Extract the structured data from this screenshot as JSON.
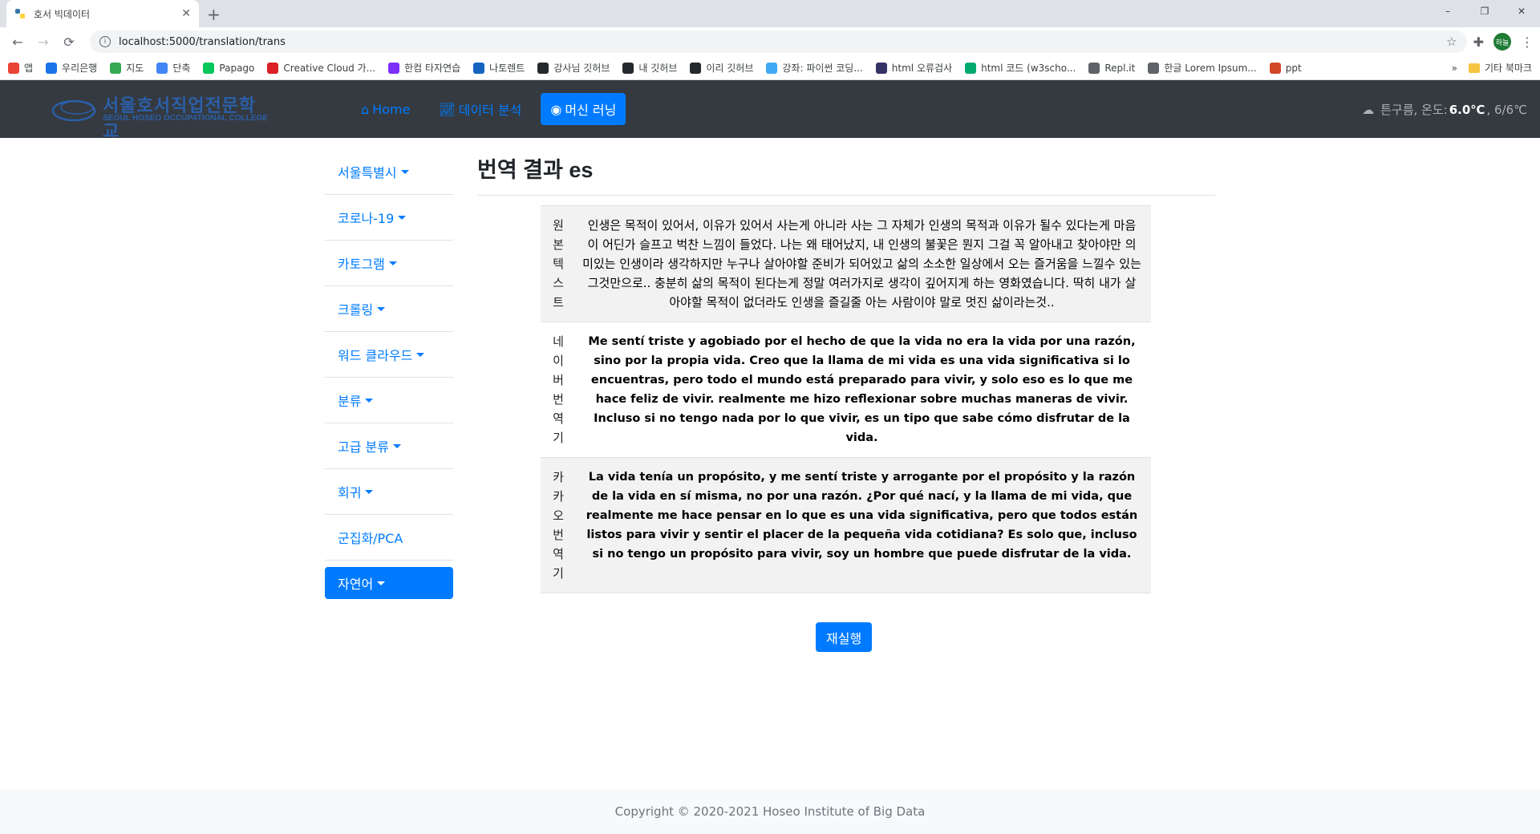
{
  "browser": {
    "tab_title": "호서 빅데이터",
    "url": "localhost:5000/translation/trans",
    "window_controls": [
      "–",
      "❐",
      "✕"
    ],
    "bookmarks": [
      {
        "label": "앱",
        "color": "#ea4335"
      },
      {
        "label": "우리은행",
        "color": "#1a73e8"
      },
      {
        "label": "지도",
        "color": "#34a853"
      },
      {
        "label": "단축",
        "color": "#4285f4"
      },
      {
        "label": "Papago",
        "color": "#03c75a"
      },
      {
        "label": "Creative Cloud 가...",
        "color": "#da1f26"
      },
      {
        "label": "한컴 타자연습",
        "color": "#7b2ff7"
      },
      {
        "label": "나토렌트",
        "color": "#1565c0"
      },
      {
        "label": "강사님 깃허브",
        "color": "#24292e"
      },
      {
        "label": "내 깃허브",
        "color": "#24292e"
      },
      {
        "label": "이리 깃허브",
        "color": "#24292e"
      },
      {
        "label": "강좌: 파이썬 코딩...",
        "color": "#3fa9f5"
      },
      {
        "label": "html 오류검사",
        "color": "#333366"
      },
      {
        "label": "html 코드 (w3scho...",
        "color": "#04aa6d"
      },
      {
        "label": "Repl.it",
        "color": "#5f6368"
      },
      {
        "label": "한글 Lorem Ipsum...",
        "color": "#5f6368"
      },
      {
        "label": "ppt",
        "color": "#d24726"
      }
    ],
    "bookmarks_overflow": "»",
    "other_bookmarks": "기타 북마크",
    "profile_initial": "하늘"
  },
  "navbar": {
    "logo_title": "서울호서직업전문학교",
    "logo_subtitle": "SEOUL HOSEO OCCUPATIONAL COLLEGE",
    "links": [
      {
        "label": "Home",
        "icon": "home-icon",
        "active": false
      },
      {
        "label": "데이터 분석",
        "icon": "chart-line-icon",
        "active": false
      },
      {
        "label": "머신 러닝",
        "icon": "brain-icon",
        "active": true
      }
    ],
    "weather": {
      "condition": "튼구름, 온도: ",
      "temp": "6.0℃",
      "range": ", 6/6℃"
    }
  },
  "sidebar": {
    "items": [
      {
        "label": "서울특별시",
        "dropdown": true
      },
      {
        "label": "코로나-19",
        "dropdown": true
      },
      {
        "label": "카토그램",
        "dropdown": true
      },
      {
        "label": "크롤링",
        "dropdown": true
      },
      {
        "label": "워드 클라우드",
        "dropdown": true
      },
      {
        "label": "분류",
        "dropdown": true
      },
      {
        "label": "고급 분류",
        "dropdown": true
      },
      {
        "label": "회귀",
        "dropdown": true
      },
      {
        "label": "군집화/PCA",
        "dropdown": false
      },
      {
        "label": "자연어",
        "dropdown": true,
        "active": true
      }
    ]
  },
  "main": {
    "title": "번역 결과 es",
    "rows": [
      {
        "label": "원본텍스트",
        "text": "인생은 목적이 있어서, 이유가 있어서 사는게 아니라 사는 그 자체가 인생의 목적과 이유가 될수 있다는게 마음이 어딘가 슬프고 벅찬 느낌이 들었다. 나는 왜 태어났지, 내 인생의 불꽃은 뭔지 그걸 꼭 알아내고 찾아야만 의미있는 인생이라 생각하지만 누구나 살아야할 준비가 되어있고 삶의 소소한 일상에서 오는 즐거움을 느낄수 있는 그것만으로.. 충분히 삶의 목적이 된다는게 정말 여러가지로 생각이 깊어지게 하는 영화였습니다. 딱히 내가 살아야할 목적이 없더라도 인생을 즐길줄 아는 사람이야 말로 멋진 삶이라는것..",
        "bold": false
      },
      {
        "label": "네이버번역기",
        "text": "Me sentí triste y agobiado por el hecho de que la vida no era la vida por una razón, sino por la propia vida. Creo que la llama de mi vida es una vida significativa si lo encuentras, pero todo el mundo está preparado para vivir, y solo eso es lo que me hace feliz de vivir. realmente me hizo reflexionar sobre muchas maneras de vivir. Incluso si no tengo nada por lo que vivir, es un tipo que sabe cómo disfrutar de la vida.",
        "bold": true
      },
      {
        "label": "카카오번역기",
        "text": "La vida tenía un propósito, y me sentí triste y arrogante por el propósito y la razón de la vida en sí misma, no por una razón. ¿Por qué nací, y la llama de mi vida, que realmente me hace pensar en lo que es una vida significativa, pero que todos están listos para vivir y sentir el placer de la pequeña vida cotidiana? Es solo que, incluso si no tengo un propósito para vivir, soy un hombre que puede disfrutar de la vida.",
        "bold": true
      }
    ],
    "rerun_label": "재실행"
  },
  "footer": {
    "copyright": "Copyright © 2020-2021 Hoseo Institute of Big Data"
  },
  "colors": {
    "primary": "#007bff",
    "navbar_bg": "#343a40",
    "striped_bg": "#f2f2f2"
  }
}
